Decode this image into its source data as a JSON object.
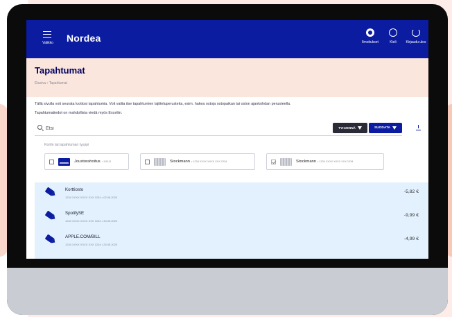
{
  "header": {
    "menu_label": "Valikko",
    "logo": "Nordea",
    "notifications_label": "Ilmoitukset",
    "language_label": "Kieli",
    "logout_label": "Kirjaudu ulos"
  },
  "page": {
    "title": "Tapahtumat",
    "breadcrumb": "Etusivu  ›  Tapahtumat",
    "intro_line1": "Tällä sivulla voit seurata luottosi tapahtumia. Voit valita itse tapahtumien lajitteluperusteita, esim. hakea ostoja ostopaikan tai oston ajankohdan perusteella.",
    "intro_line2": "Tapahtumatiedot on mahdollista viedä myös Exceliin."
  },
  "search": {
    "placeholder": "Etsi",
    "clear_label": "TYHJENNÄ",
    "filter_label": "SUODATA"
  },
  "card_filter": {
    "label": "Kortin tai tapahtuman tyyppi",
    "cards": [
      {
        "name": "Joustorahoitus",
        "number": "• 111111",
        "checked": false,
        "thumb": "blue"
      },
      {
        "name": "Stockmann",
        "number": "• 1234 XXXX XXXX XXX 1234",
        "checked": false,
        "thumb": "grey"
      },
      {
        "name": "Stockmann",
        "number": "• 1234 XXXX XXXX XXX 1234",
        "checked": true,
        "thumb": "grey"
      }
    ]
  },
  "transactions": [
    {
      "name": "Korttiosto",
      "meta": "1234 XXXX XXXX XXX 1234 • 02.06.2020",
      "amount": "-5,82 €"
    },
    {
      "name": "SpotifySE",
      "meta": "1234 XXXX XXXX XXX 1234 • 30.05.2020",
      "amount": "-9,99 €"
    },
    {
      "name": "APPLE.COM/BILL",
      "meta": "1234 XXXX XXXX XXX 1234 • 24.05.2020",
      "amount": "-4,99 €"
    }
  ],
  "colors": {
    "brand_blue": "#0b1ca0",
    "title_navy": "#00005e",
    "title_bg": "#fbe6de",
    "transaction_bg": "#e2f1fd"
  }
}
